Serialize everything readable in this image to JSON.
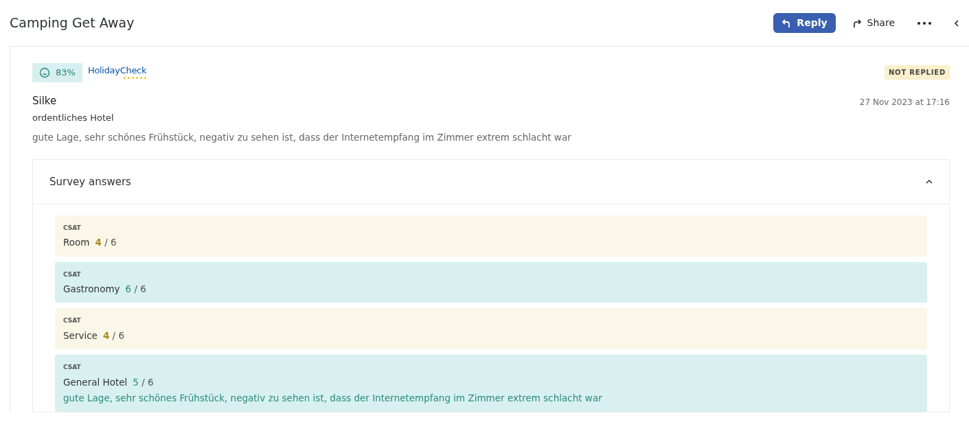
{
  "header": {
    "title": "Camping Get Away",
    "actions": [
      {
        "kind": "primary",
        "label": "Reply"
      },
      {
        "kind": "share",
        "label": "Share"
      },
      {
        "kind": "more"
      },
      {
        "kind": "collapse"
      }
    ]
  },
  "review": {
    "score": "83%",
    "source": "HolidayCheck",
    "status": "NOT REPLIED",
    "author": "Silke",
    "date": "27 Nov 2023 at 17:16",
    "title": "ordentliches Hotel",
    "text": "gute Lage, sehr schönes Frühstück, negativ zu sehen ist, dass der Internetempfang im Zimmer extrem schlacht war",
    "survey": {
      "title": "Survey answers",
      "expanded": true,
      "answers": [
        {
          "kind": "neutral",
          "type": "CSAT",
          "label": "Room",
          "score": "4",
          "max": "/ 6"
        },
        {
          "kind": "positive",
          "type": "CSAT",
          "label": "Gastronomy",
          "score": "6",
          "max": "/ 6"
        },
        {
          "kind": "neutral",
          "type": "CSAT",
          "label": "Service",
          "score": "4",
          "max": "/ 6"
        },
        {
          "kind": "positive",
          "type": "CSAT",
          "label": "General Hotel",
          "score": "5",
          "max": "/ 6",
          "comment": "gute Lage, sehr schönes Frühstück, negativ zu sehen ist, dass der Internetempfang im Zimmer extrem schlacht war"
        }
      ]
    }
  }
}
